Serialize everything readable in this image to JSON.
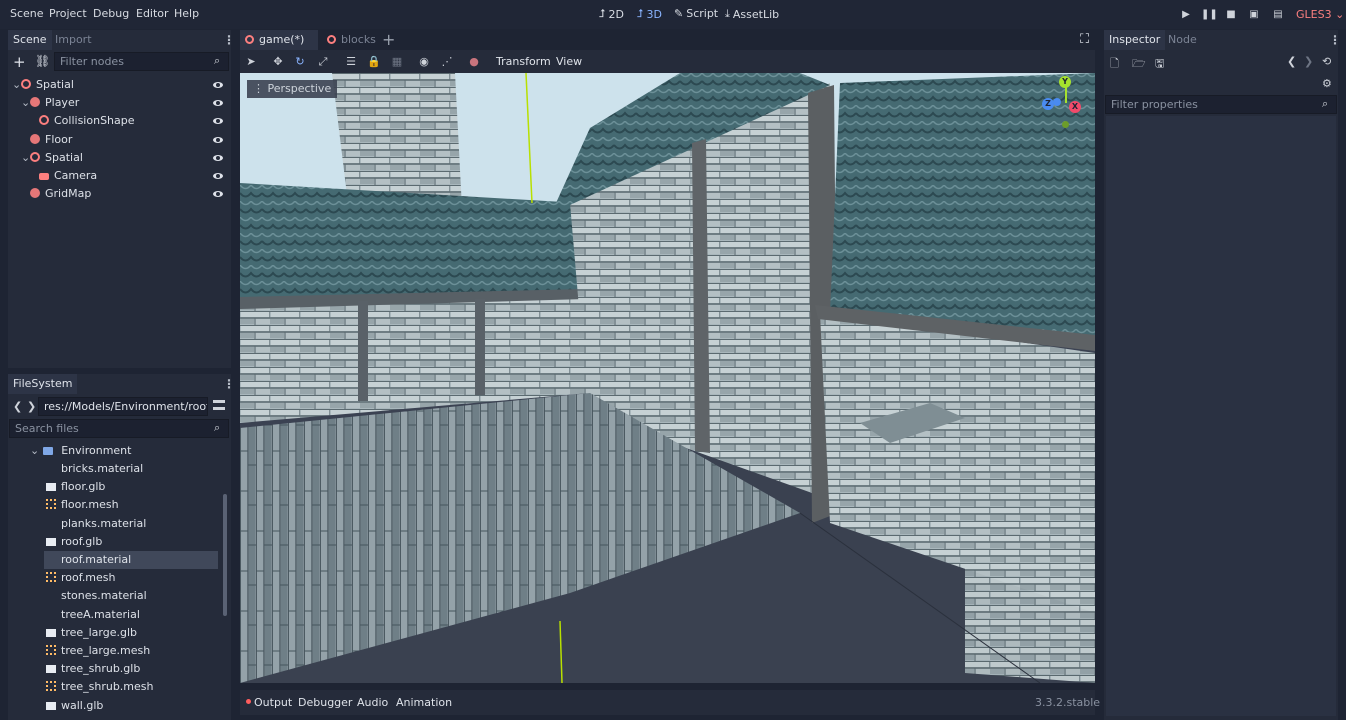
{
  "menu": [
    "Scene",
    "Project",
    "Debug",
    "Editor",
    "Help"
  ],
  "modes": [
    {
      "label": "2D",
      "icon": "2d-icon"
    },
    {
      "label": "3D",
      "icon": "3d-icon"
    },
    {
      "label": "Script",
      "icon": "script-icon"
    },
    {
      "label": "AssetLib",
      "icon": "assetlib-icon"
    }
  ],
  "renderer": "GLES3",
  "scene_dock": {
    "tabs": [
      "Scene",
      "Import"
    ],
    "filter_placeholder": "Filter nodes",
    "nodes": [
      {
        "label": "Spatial",
        "depth": 0,
        "arrow": "v",
        "icon": "spatial-icon",
        "color": "#fc7f7f"
      },
      {
        "label": "Player",
        "depth": 1,
        "arrow": "v",
        "icon": "kinematic-body-icon",
        "color": "#fc7f7f"
      },
      {
        "label": "CollisionShape",
        "depth": 2,
        "arrow": "",
        "icon": "collision-shape-icon",
        "color": "#fc7f7f"
      },
      {
        "label": "Floor",
        "depth": 1,
        "arrow": "",
        "icon": "static-body-icon",
        "color": "#fc7f7f"
      },
      {
        "label": "Spatial",
        "depth": 1,
        "arrow": "v",
        "icon": "spatial-icon",
        "color": "#fc7f7f"
      },
      {
        "label": "Camera",
        "depth": 2,
        "arrow": "",
        "icon": "camera-icon",
        "color": "#fc7f7f"
      },
      {
        "label": "GridMap",
        "depth": 1,
        "arrow": "",
        "icon": "gridmap-icon",
        "color": "#fc7f7f"
      }
    ]
  },
  "filesystem": {
    "title": "FileSystem",
    "path": "res://Models/Environment/roof.ma",
    "search_placeholder": "Search files",
    "folder": "Environment",
    "files": [
      {
        "name": "bricks.material",
        "type": "material"
      },
      {
        "name": "floor.glb",
        "type": "glb"
      },
      {
        "name": "floor.mesh",
        "type": "mesh"
      },
      {
        "name": "planks.material",
        "type": "material"
      },
      {
        "name": "roof.glb",
        "type": "glb"
      },
      {
        "name": "roof.material",
        "type": "material",
        "selected": true
      },
      {
        "name": "roof.mesh",
        "type": "mesh"
      },
      {
        "name": "stones.material",
        "type": "material"
      },
      {
        "name": "treeA.material",
        "type": "material"
      },
      {
        "name": "tree_large.glb",
        "type": "glb"
      },
      {
        "name": "tree_large.mesh",
        "type": "mesh"
      },
      {
        "name": "tree_shrub.glb",
        "type": "glb"
      },
      {
        "name": "tree_shrub.mesh",
        "type": "mesh"
      },
      {
        "name": "wall.glb",
        "type": "glb"
      }
    ]
  },
  "editor_tabs": [
    "game(*)",
    "blocks"
  ],
  "toolbar": {
    "transform": "Transform",
    "view": "View"
  },
  "viewport": {
    "label": "Perspective"
  },
  "gizmo": {
    "y": "Y",
    "z": "Z",
    "x": "X"
  },
  "bottom_tabs": [
    "Output",
    "Debugger",
    "Audio",
    "Animation"
  ],
  "version": "3.3.2.stable",
  "inspector": {
    "tabs": [
      "Inspector",
      "Node"
    ],
    "filter_placeholder": "Filter properties"
  }
}
